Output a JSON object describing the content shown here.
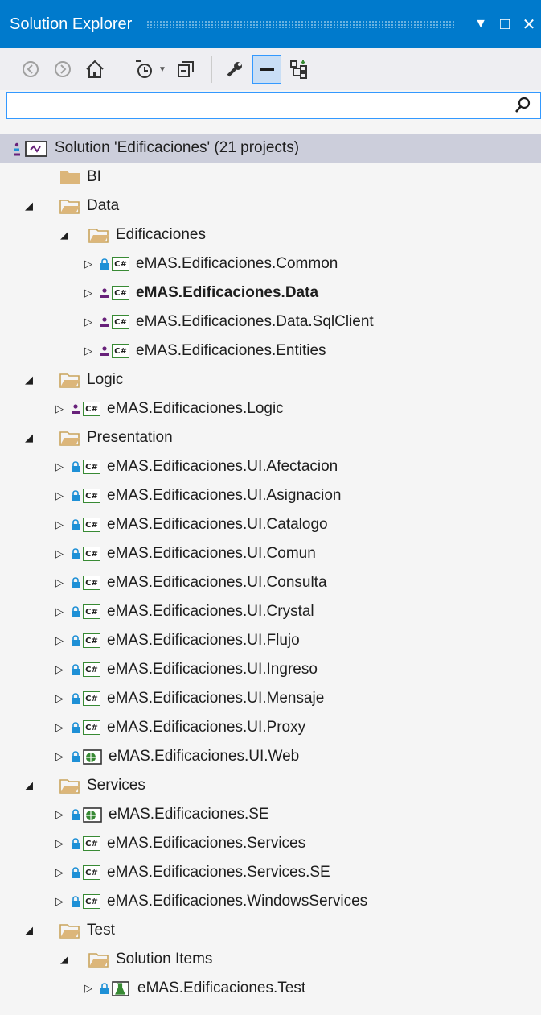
{
  "window": {
    "title": "Solution Explorer",
    "dropdown_glyph": "▼",
    "maximize_glyph": "□",
    "close_glyph": "✕"
  },
  "search": {
    "value": "",
    "placeholder": ""
  },
  "colors": {
    "accent": "#007acc",
    "selection": "#cccedb",
    "csharp_border": "#388a34",
    "folder": "#dcb67a",
    "lock": "#1e90d6",
    "person": "#68217a"
  },
  "toolbar": {
    "buttons": [
      "back-icon",
      "forward-icon",
      "home-icon",
      "pending-changes-icon",
      "collapse-all-icon",
      "properties-icon",
      "preview-selected-icon",
      "class-view-icon"
    ]
  },
  "tree": {
    "solution_label": "Solution 'Edificaciones' (21 projects)",
    "rows": [
      {
        "kind": "folder",
        "label": "BI"
      },
      {
        "kind": "folder",
        "label": "Data"
      },
      {
        "kind": "folder",
        "label": "Edificaciones"
      },
      {
        "kind": "project",
        "label": "eMAS.Edificaciones.Common"
      },
      {
        "kind": "project",
        "label": "eMAS.Edificaciones.Data"
      },
      {
        "kind": "project",
        "label": "eMAS.Edificaciones.Data.SqlClient"
      },
      {
        "kind": "project",
        "label": "eMAS.Edificaciones.Entities"
      },
      {
        "kind": "folder",
        "label": "Logic"
      },
      {
        "kind": "project",
        "label": "eMAS.Edificaciones.Logic"
      },
      {
        "kind": "folder",
        "label": "Presentation"
      },
      {
        "kind": "project",
        "label": "eMAS.Edificaciones.UI.Afectacion"
      },
      {
        "kind": "project",
        "label": "eMAS.Edificaciones.UI.Asignacion"
      },
      {
        "kind": "project",
        "label": "eMAS.Edificaciones.UI.Catalogo"
      },
      {
        "kind": "project",
        "label": "eMAS.Edificaciones.UI.Comun"
      },
      {
        "kind": "project",
        "label": "eMAS.Edificaciones.UI.Consulta"
      },
      {
        "kind": "project",
        "label": "eMAS.Edificaciones.UI.Crystal"
      },
      {
        "kind": "project",
        "label": "eMAS.Edificaciones.UI.Flujo"
      },
      {
        "kind": "project",
        "label": "eMAS.Edificaciones.UI.Ingreso"
      },
      {
        "kind": "project",
        "label": "eMAS.Edificaciones.UI.Mensaje"
      },
      {
        "kind": "project",
        "label": "eMAS.Edificaciones.UI.Proxy"
      },
      {
        "kind": "project",
        "label": "eMAS.Edificaciones.UI.Web"
      },
      {
        "kind": "folder",
        "label": "Services"
      },
      {
        "kind": "project",
        "label": "eMAS.Edificaciones.SE"
      },
      {
        "kind": "project",
        "label": "eMAS.Edificaciones.Services"
      },
      {
        "kind": "project",
        "label": "eMAS.Edificaciones.Services.SE"
      },
      {
        "kind": "project",
        "label": "eMAS.Edificaciones.WindowsServices"
      },
      {
        "kind": "folder",
        "label": "Test"
      },
      {
        "kind": "folder",
        "label": "Solution Items"
      },
      {
        "kind": "project",
        "label": "eMAS.Edificaciones.Test"
      }
    ]
  }
}
